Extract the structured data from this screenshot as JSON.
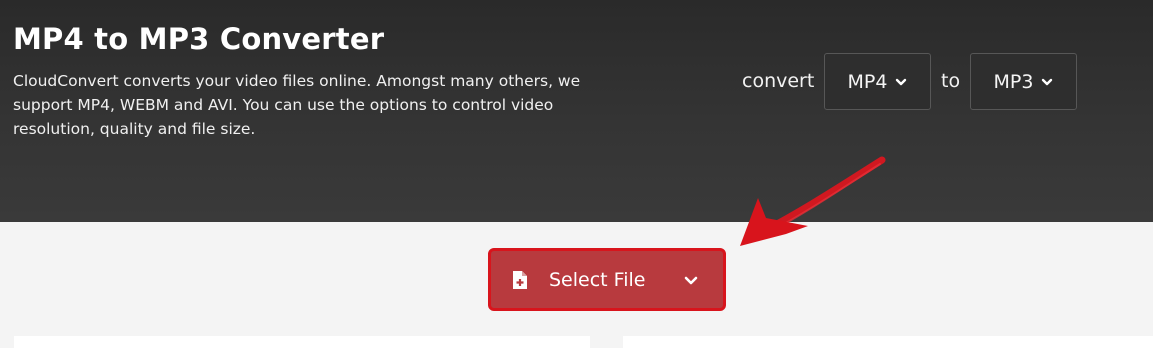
{
  "header": {
    "title": "MP4 to MP3 Converter",
    "description": "CloudConvert converts your video files online. Amongst many others, we support MP4, WEBM and AVI. You can use the options to control video resolution, quality and file size."
  },
  "converter": {
    "convert_label": "convert",
    "from_format": "MP4",
    "to_label": "to",
    "to_format": "MP3"
  },
  "upload": {
    "select_file_label": "Select File"
  },
  "colors": {
    "header_background": "#2f2f2f",
    "accent_red": "#d8141c",
    "button_fill": "#b83a3e",
    "page_background": "#f4f4f4"
  },
  "icons": {
    "from_dropdown": "chevron-down-icon",
    "to_dropdown": "chevron-down-icon",
    "select_file": "file-plus-icon",
    "select_file_menu": "chevron-down-icon",
    "annotation": "red-arrow-icon"
  }
}
